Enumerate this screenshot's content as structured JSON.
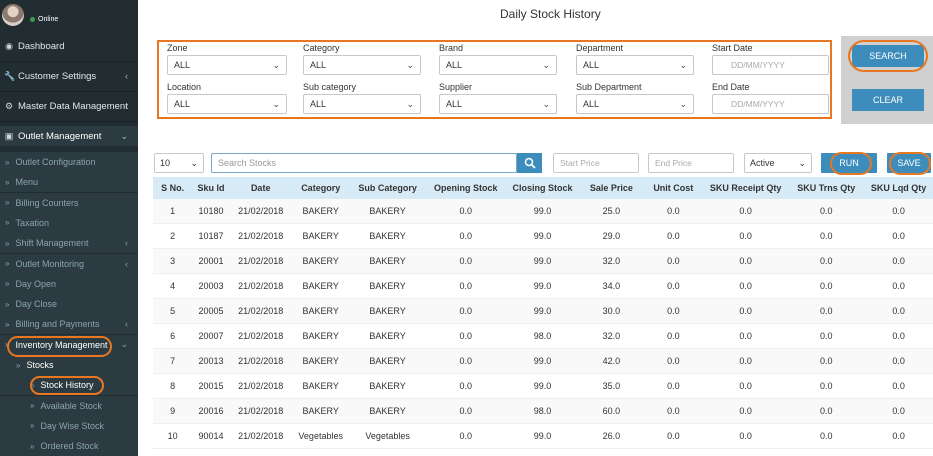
{
  "sidebar": {
    "user": {
      "name": "",
      "status": "Online"
    },
    "items": [
      {
        "label": "Dashboard",
        "icon": "dashboard-icon",
        "glyph": "◉",
        "chevron": false
      },
      {
        "label": "Customer Settings",
        "icon": "wrench-icon",
        "glyph": "🔧",
        "chevron": true
      },
      {
        "label": "Master Data Management",
        "icon": "gear-icon",
        "glyph": "⚙",
        "chevron": true
      },
      {
        "label": "Outlet Management",
        "icon": "store-icon",
        "glyph": "▣",
        "chevron": true
      }
    ],
    "subitems": [
      {
        "label": "Outlet Configuration",
        "chevron": false
      },
      {
        "label": "Menu",
        "chevron": false
      },
      {
        "label": "Billing Counters",
        "chevron": false
      },
      {
        "label": "Taxation",
        "chevron": false
      },
      {
        "label": "Shift Management",
        "chevron": true
      },
      {
        "label": "Outlet Monitoring",
        "chevron": true
      },
      {
        "label": "Day Open",
        "chevron": false
      },
      {
        "label": "Day Close",
        "chevron": false
      },
      {
        "label": "Billing and Payments",
        "chevron": true
      },
      {
        "label": "Inventory Management",
        "chevron": true
      },
      {
        "label": "Stocks",
        "chevron": false
      },
      {
        "label": "Stock History",
        "chevron": false
      },
      {
        "label": "Available Stock",
        "chevron": false
      },
      {
        "label": "Day Wise Stock",
        "chevron": false
      },
      {
        "label": "Ordered Stock",
        "chevron": false
      }
    ]
  },
  "page": {
    "title": "Daily Stock History"
  },
  "filters": {
    "zone": {
      "label": "Zone",
      "value": "ALL"
    },
    "category": {
      "label": "Category",
      "value": "ALL"
    },
    "brand": {
      "label": "Brand",
      "value": "ALL"
    },
    "department": {
      "label": "Department",
      "value": "ALL"
    },
    "start_date": {
      "label": "Start Date",
      "placeholder": "DD/MM/YYYY"
    },
    "location": {
      "label": "Location",
      "value": "ALL"
    },
    "sub_category": {
      "label": "Sub category",
      "value": "ALL"
    },
    "supplier": {
      "label": "Supplier",
      "value": "ALL"
    },
    "sub_department": {
      "label": "Sub Department",
      "value": "ALL"
    },
    "end_date": {
      "label": "End Date",
      "placeholder": "DD/MM/YYYY"
    }
  },
  "actions": {
    "search": "SEARCH",
    "clear": "CLEAR",
    "run": "RUN",
    "save": "SAVE"
  },
  "toolbar": {
    "page_size": "10",
    "search_placeholder": "Search Stocks",
    "start_price_placeholder": "Start Price",
    "end_price_placeholder": "End Price",
    "status": "Active"
  },
  "colors": {
    "accent": "#3c8dbc",
    "highlight": "#e87722",
    "sidebar": "#222d32",
    "header_row": "#d7ebf7"
  },
  "table": {
    "columns": [
      "S No.",
      "Sku Id",
      "Date",
      "Category",
      "Sub Category",
      "Opening Stock",
      "Closing Stock",
      "Sale Price",
      "Unit Cost",
      "SKU Receipt Qty",
      "SKU Trns Qty",
      "SKU Lqd Qty"
    ],
    "rows": [
      [
        "1",
        "10180",
        "21/02/2018",
        "BAKERY",
        "BAKERY",
        "0.0",
        "99.0",
        "25.0",
        "0.0",
        "0.0",
        "0.0",
        "0.0"
      ],
      [
        "2",
        "10187",
        "21/02/2018",
        "BAKERY",
        "BAKERY",
        "0.0",
        "99.0",
        "29.0",
        "0.0",
        "0.0",
        "0.0",
        "0.0"
      ],
      [
        "3",
        "20001",
        "21/02/2018",
        "BAKERY",
        "BAKERY",
        "0.0",
        "99.0",
        "32.0",
        "0.0",
        "0.0",
        "0.0",
        "0.0"
      ],
      [
        "4",
        "20003",
        "21/02/2018",
        "BAKERY",
        "BAKERY",
        "0.0",
        "99.0",
        "34.0",
        "0.0",
        "0.0",
        "0.0",
        "0.0"
      ],
      [
        "5",
        "20005",
        "21/02/2018",
        "BAKERY",
        "BAKERY",
        "0.0",
        "99.0",
        "30.0",
        "0.0",
        "0.0",
        "0.0",
        "0.0"
      ],
      [
        "6",
        "20007",
        "21/02/2018",
        "BAKERY",
        "BAKERY",
        "0.0",
        "98.0",
        "32.0",
        "0.0",
        "0.0",
        "0.0",
        "0.0"
      ],
      [
        "7",
        "20013",
        "21/02/2018",
        "BAKERY",
        "BAKERY",
        "0.0",
        "99.0",
        "42.0",
        "0.0",
        "0.0",
        "0.0",
        "0.0"
      ],
      [
        "8",
        "20015",
        "21/02/2018",
        "BAKERY",
        "BAKERY",
        "0.0",
        "99.0",
        "35.0",
        "0.0",
        "0.0",
        "0.0",
        "0.0"
      ],
      [
        "9",
        "20016",
        "21/02/2018",
        "BAKERY",
        "BAKERY",
        "0.0",
        "98.0",
        "60.0",
        "0.0",
        "0.0",
        "0.0",
        "0.0"
      ],
      [
        "10",
        "90014",
        "21/02/2018",
        "Vegetables",
        "Vegetables",
        "0.0",
        "99.0",
        "26.0",
        "0.0",
        "0.0",
        "0.0",
        "0.0"
      ]
    ]
  }
}
